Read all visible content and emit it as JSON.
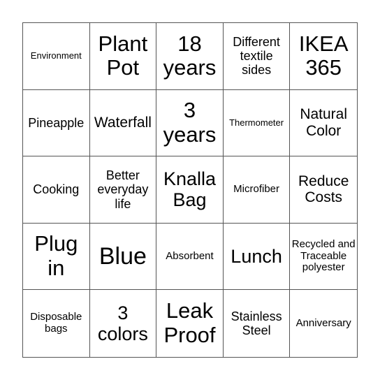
{
  "board": {
    "cells": [
      {
        "text": "Environment",
        "size": "s-xs"
      },
      {
        "text": "Plant Pot",
        "size": "s-xl"
      },
      {
        "text": "18 years",
        "size": "s-xl"
      },
      {
        "text": "Different textile sides",
        "size": "s-md"
      },
      {
        "text": "IKEA 365",
        "size": "s-xl"
      },
      {
        "text": "Pineapple",
        "size": "s-md"
      },
      {
        "text": "Waterfall",
        "size": "s-md2"
      },
      {
        "text": "3 years",
        "size": "s-xl"
      },
      {
        "text": "Thermometer",
        "size": "s-xs"
      },
      {
        "text": "Natural Color",
        "size": "s-md2"
      },
      {
        "text": "Cooking",
        "size": "s-md"
      },
      {
        "text": "Better everyday life",
        "size": "s-md"
      },
      {
        "text": "Knalla Bag",
        "size": "s-lg"
      },
      {
        "text": "Microfiber",
        "size": "s-sm"
      },
      {
        "text": "Reduce Costs",
        "size": "s-md2"
      },
      {
        "text": "Plug in",
        "size": "s-xl"
      },
      {
        "text": "Blue",
        "size": "s-xxl"
      },
      {
        "text": "Absorbent",
        "size": "s-sm"
      },
      {
        "text": "Lunch",
        "size": "s-lg"
      },
      {
        "text": "Recycled and Traceable polyester",
        "size": "s-sm"
      },
      {
        "text": "Disposable bags",
        "size": "s-sm"
      },
      {
        "text": "3 colors",
        "size": "s-lg"
      },
      {
        "text": "Leak Proof",
        "size": "s-xl"
      },
      {
        "text": "Stainless Steel",
        "size": "s-md"
      },
      {
        "text": "Anniversary",
        "size": "s-sm"
      }
    ]
  }
}
